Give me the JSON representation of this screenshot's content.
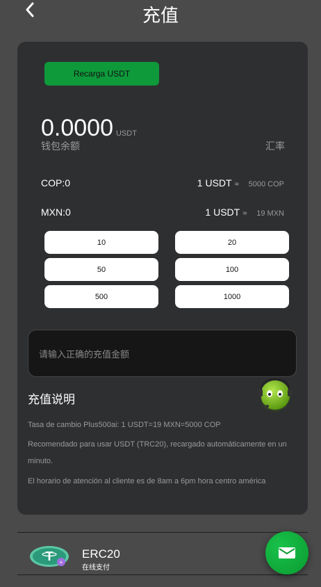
{
  "header": {
    "title": "充值",
    "back_icon": "chevron-left-icon"
  },
  "tab": {
    "label": "Recarga USDT",
    "color": "#0e9a3b"
  },
  "balance": {
    "value": "0.0000",
    "unit": "USDT",
    "label": "钱包余额",
    "rate_label": "汇率"
  },
  "rates": [
    {
      "currency": "COP:0",
      "usdt": "1 USDT",
      "approx": "≈",
      "target": "5000 COP"
    },
    {
      "currency": "MXN:0",
      "usdt": "1 USDT",
      "approx": "≈",
      "target": "19 MXN"
    }
  ],
  "amounts": [
    "10",
    "20",
    "50",
    "100",
    "500",
    "1000"
  ],
  "input": {
    "placeholder": "请输入正确的充值金额"
  },
  "description": {
    "title": "充值说明",
    "lines": [
      "Tasa de cambio Plus500ai: 1 USDT=19 MXN=5000 COP",
      "Recomendado para usar USDT (TRC20), recargado automáticamente en un",
      "minuto.",
      "El horario de atención al cliente es de 8am a 6pm hora centro américa"
    ]
  },
  "payment": {
    "name": "ERC20",
    "subtitle": "在线支付",
    "icon": "tether-coin-icon"
  },
  "fab": {
    "icon": "mail-icon",
    "color": "#0a9a2f"
  }
}
